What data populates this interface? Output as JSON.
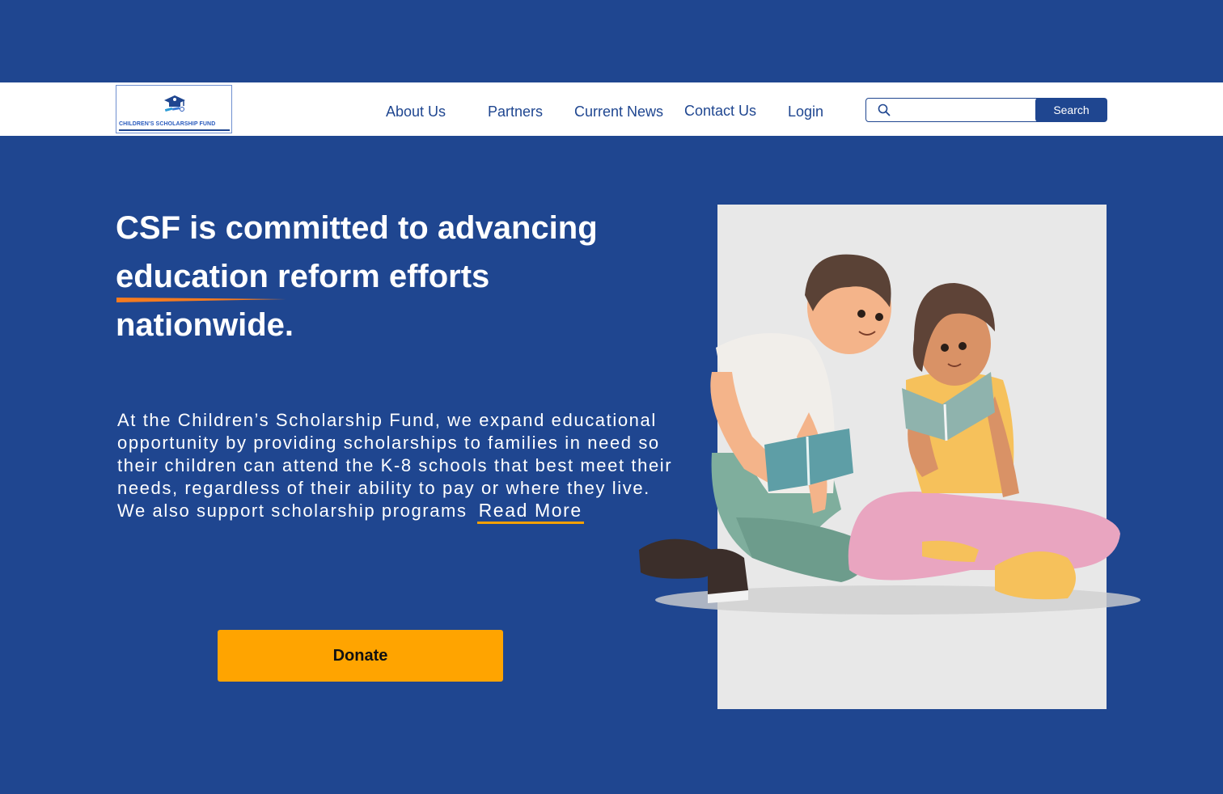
{
  "brand": {
    "logo_text": "CHILDREN'S   SCHOLARSHIP FUND",
    "primary_color": "#1f4690",
    "accent_color": "#ffa400"
  },
  "nav": {
    "items": [
      {
        "label": "About Us"
      },
      {
        "label": "Partners"
      },
      {
        "label": "Current News"
      },
      {
        "label": "Contact Us"
      },
      {
        "label": "Login"
      }
    ]
  },
  "search": {
    "placeholder": "",
    "value": "",
    "button_label": "Search",
    "icon": "search-icon"
  },
  "hero": {
    "headline": "CSF is committed to advancing education reform efforts nationwide.",
    "body": "At the Children’s Scholarship Fund, we expand educational opportunity by providing scholarships to families in need so their children can attend the K-8 schools that best meet their needs, regardless of their ability to pay or where they live. We also support scholarship programs",
    "read_more_label": "Read More",
    "donate_label": "Donate"
  }
}
